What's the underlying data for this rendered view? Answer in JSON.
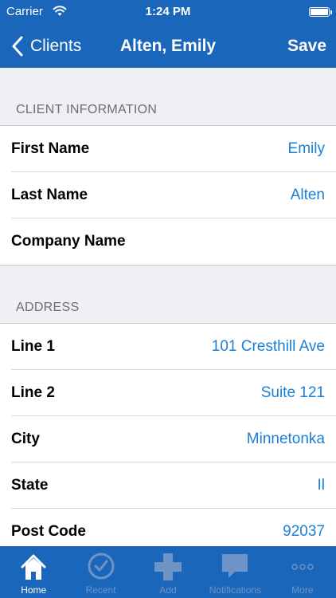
{
  "status_bar": {
    "carrier": "Carrier",
    "time": "1:24 PM"
  },
  "nav": {
    "back_label": "Clients",
    "title": "Alten, Emily",
    "save_label": "Save"
  },
  "sections": [
    {
      "title": "CLIENT INFORMATION",
      "rows": [
        {
          "label": "First Name",
          "value": "Emily"
        },
        {
          "label": "Last Name",
          "value": "Alten"
        },
        {
          "label": "Company Name",
          "value": ""
        }
      ]
    },
    {
      "title": "ADDRESS",
      "rows": [
        {
          "label": "Line 1",
          "value": "101 Cresthill Ave"
        },
        {
          "label": "Line 2",
          "value": "Suite 121"
        },
        {
          "label": "City",
          "value": "Minnetonka"
        },
        {
          "label": "State",
          "value": "Il"
        },
        {
          "label": "Post Code",
          "value": "92037"
        }
      ]
    }
  ],
  "tabs": [
    {
      "label": "Home",
      "icon": "home-icon",
      "active": true
    },
    {
      "label": "Recent",
      "icon": "clock-icon",
      "active": false
    },
    {
      "label": "Add",
      "icon": "plus-icon",
      "active": false
    },
    {
      "label": "Notifications",
      "icon": "chat-bubble-icon",
      "active": false
    },
    {
      "label": "More",
      "icon": "more-dots-icon",
      "active": false
    }
  ],
  "colors": {
    "brand": "#1a66bb",
    "value_text": "#1a7fd6",
    "inactive_tab": "#6f93c4",
    "background": "#efeff4"
  }
}
